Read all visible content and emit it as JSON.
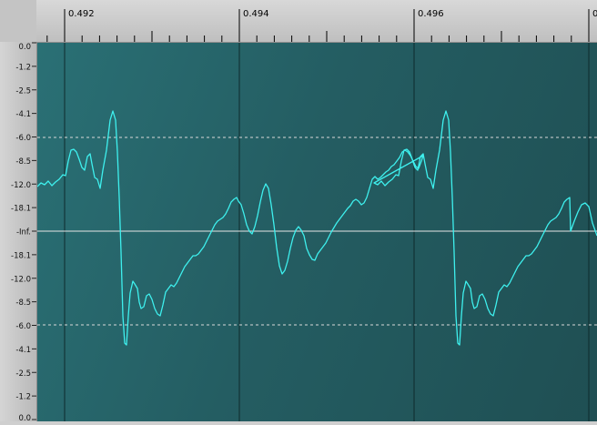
{
  "timeline": {
    "ticks_major": [
      "0.492",
      "0.494",
      "0.496",
      "0"
    ]
  },
  "db_scale": {
    "labels": [
      "0.0",
      "-1.2",
      "-2.5",
      "-4.1",
      "-6.0",
      "-8.5",
      "-12.0",
      "-18.1",
      "-Inf.",
      "-18.1",
      "-12.0",
      "-8.5",
      "-6.0",
      "-4.1",
      "-2.5",
      "-1.2",
      "0.0"
    ]
  },
  "colors": {
    "waveform": "#3ef0ee",
    "background": "#235a5e",
    "guide": "#d8d8d8",
    "centerline": "#e6e6e6"
  }
}
